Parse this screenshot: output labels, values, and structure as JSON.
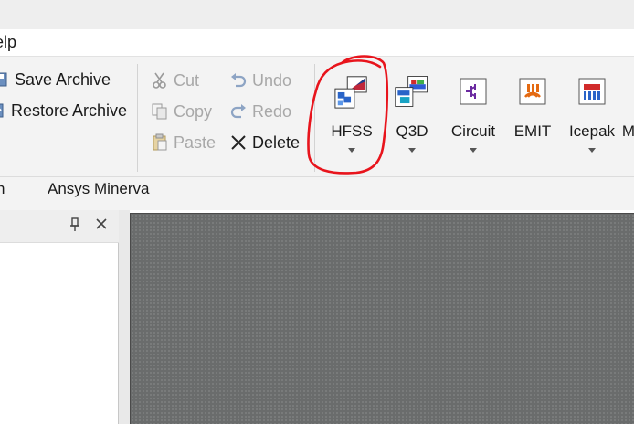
{
  "menu": {
    "help_fragment": "elp"
  },
  "ribbon": {
    "archive": {
      "save_label": "Save Archive",
      "restore_label": "Restore Archive"
    },
    "edit": {
      "cut_label": "Cut",
      "copy_label": "Copy",
      "paste_label": "Paste",
      "undo_label": "Undo",
      "redo_label": "Redo",
      "delete_label": "Delete"
    },
    "designs": [
      {
        "label": "HFSS",
        "icon": "hfss-icon"
      },
      {
        "label": "Q3D",
        "icon": "q3d-icon"
      },
      {
        "label": "Circuit",
        "icon": "circuit-icon"
      },
      {
        "label": "EMIT",
        "icon": "emit-icon"
      },
      {
        "label": "Icepak",
        "icon": "icepak-icon"
      },
      {
        "label": "M",
        "icon": ""
      }
    ]
  },
  "group_labels": {
    "left_fragment": "n",
    "minerva": "Ansys Minerva"
  },
  "panel": {
    "pin_icon": "pin-icon",
    "close_icon": "close-icon"
  },
  "annotation": {
    "color": "#e8141c"
  },
  "colors": {
    "viewport": "#6a6c6c",
    "ribbon": "#f3f3f3"
  }
}
